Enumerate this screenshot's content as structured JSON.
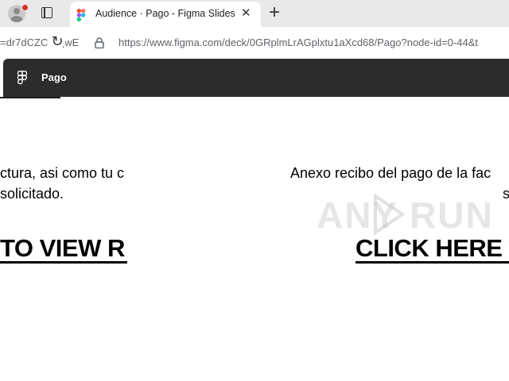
{
  "browser": {
    "tab": {
      "title": "Audience · Pago - Figma Slides",
      "close_glyph": "✕",
      "favicon": "figma-icon"
    },
    "new_tab_glyph": "+",
    "address": {
      "left_fragment": "=dr7dCZC  stqwE",
      "url": "https://www.figma.com/deck/0GRplmLrAGplxtu1aXcd68/Pago?node-id=0-44&t",
      "reload_glyph": "↻"
    }
  },
  "figma": {
    "deck_name": "Pago"
  },
  "slides": {
    "left": {
      "line1": "ctura, asi como tu c",
      "line2": "solicitado.",
      "cta": "TO VIEW R"
    },
    "right": {
      "line1": "Anexo recibo del pago de la fac",
      "line2": "s",
      "cta": "CLICK HERE T"
    }
  },
  "watermark": {
    "text": "ANY  RUN"
  },
  "colors": {
    "tabstrip": "#e9e9e9",
    "figma_header": "#2c2c2c",
    "profile_badge": "#d93025"
  }
}
